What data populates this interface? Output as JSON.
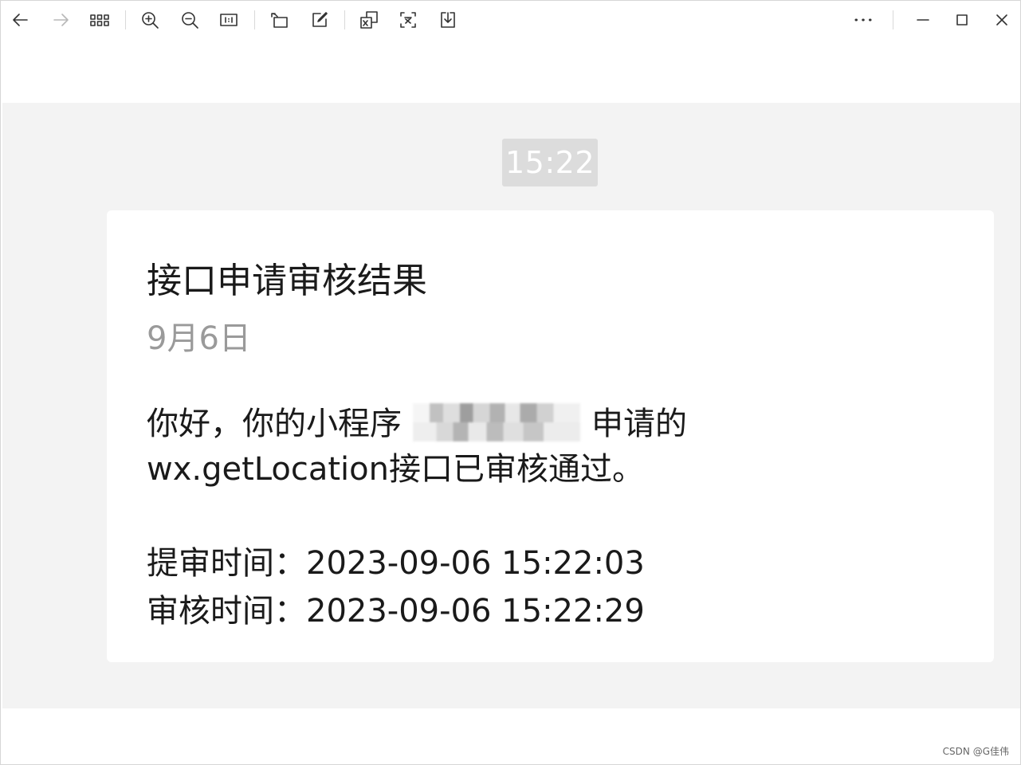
{
  "toolbar": {
    "buttons": [
      {
        "name": "back-icon"
      },
      {
        "name": "forward-icon"
      },
      {
        "name": "grid-view-icon"
      },
      {
        "name": "zoom-in-icon"
      },
      {
        "name": "zoom-out-icon"
      },
      {
        "name": "actual-size-icon"
      },
      {
        "name": "rotate-icon"
      },
      {
        "name": "edit-icon"
      },
      {
        "name": "translate-icon"
      },
      {
        "name": "extract-text-icon"
      },
      {
        "name": "download-icon"
      }
    ],
    "window_controls": [
      "more-icon",
      "minimize-icon",
      "maximize-icon",
      "close-icon"
    ]
  },
  "chat": {
    "timestamp": "15:22",
    "card": {
      "title": "接口申请审核结果",
      "date": "9月6日",
      "line1_prefix": "你好，你的小程序",
      "line1_suffix": "申请的",
      "line2": "wx.getLocation接口已审核通过。",
      "submit_time": "提审时间：2023-09-06 15:22:03",
      "review_time": "审核时间：2023-09-06 15:22:29"
    }
  },
  "watermark": "CSDN @G佳伟",
  "colors": {
    "stage_background": "#f3f3f3",
    "card_background": "#ffffff",
    "timestamp_pill": "#dcdcdc",
    "date_text": "#9a9a9a"
  }
}
